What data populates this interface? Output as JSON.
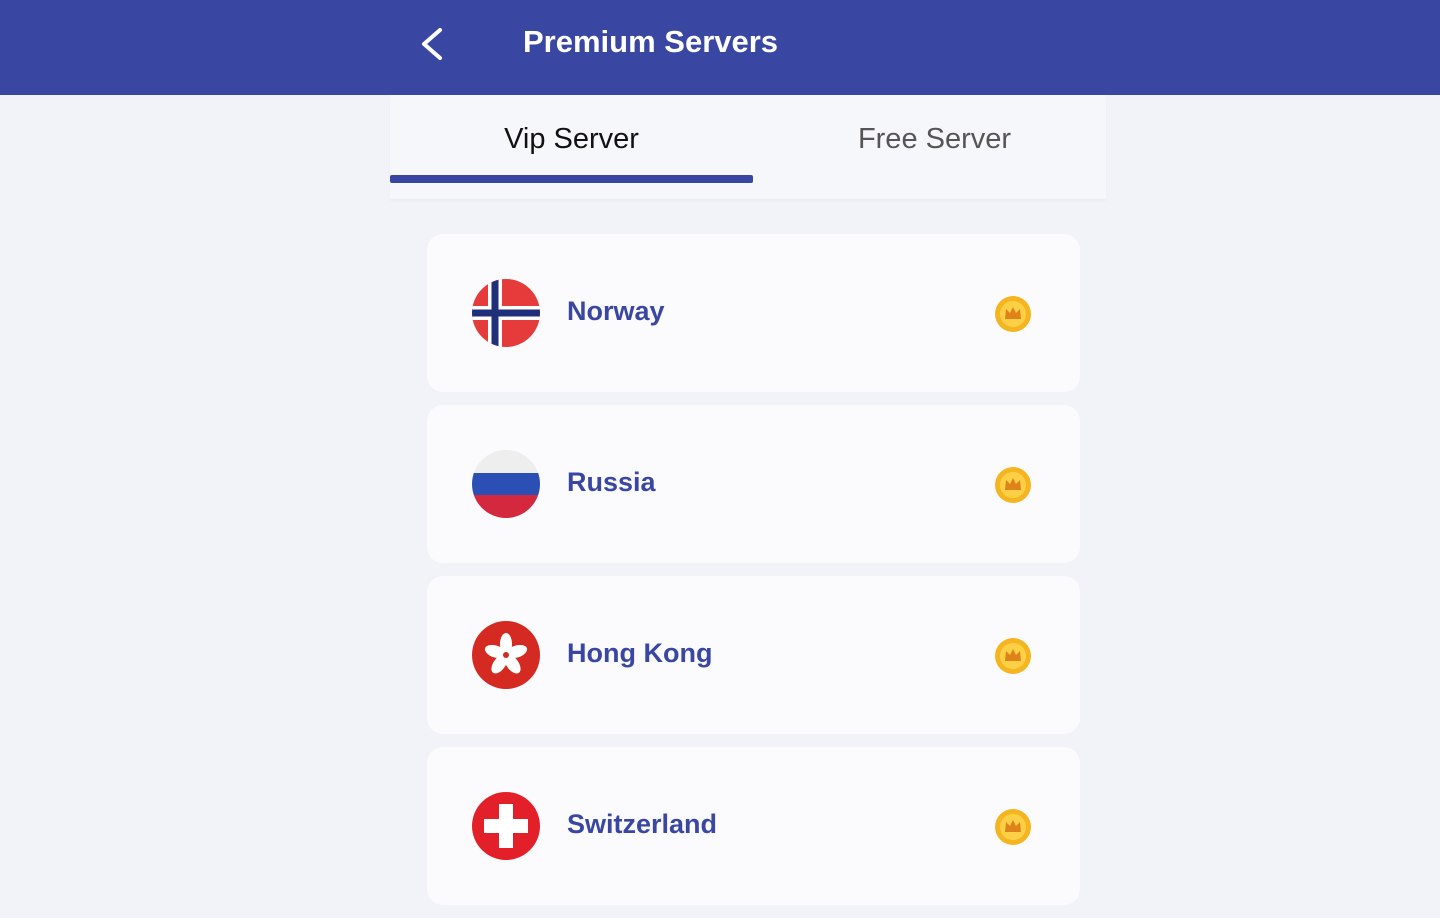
{
  "header": {
    "title": "Premium Servers",
    "back_icon": "chevron-left-icon",
    "background_color": "#3a47a2"
  },
  "tabs": [
    {
      "label": "Vip Server",
      "selected": true
    },
    {
      "label": "Free Server",
      "selected": false
    }
  ],
  "servers": [
    {
      "country": "Norway",
      "flag_icon": "norway-flag-icon",
      "badge_icon": "crown-icon"
    },
    {
      "country": "Russia",
      "flag_icon": "russia-flag-icon",
      "badge_icon": "crown-icon"
    },
    {
      "country": "Hong Kong",
      "flag_icon": "hong-kong-flag-icon",
      "badge_icon": "crown-icon"
    },
    {
      "country": "Switzerland",
      "flag_icon": "switzerland-flag-icon",
      "badge_icon": "crown-icon"
    }
  ],
  "colors": {
    "accent": "#3a47a2",
    "premium_badge": "#f5b521",
    "page_background": "#f1f3f9"
  }
}
